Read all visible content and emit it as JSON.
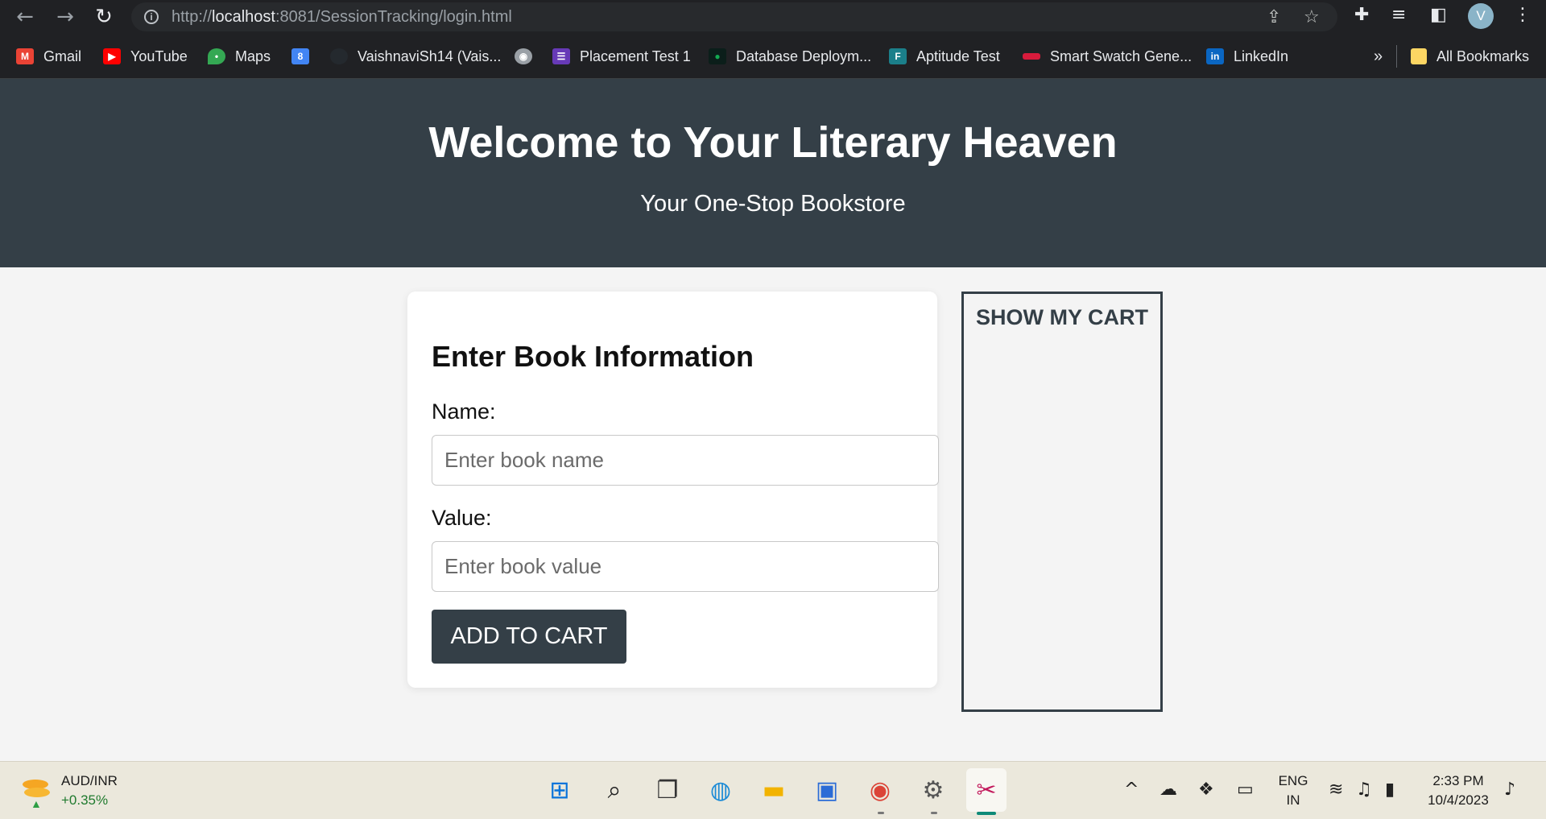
{
  "browser": {
    "url_prefix": "http://",
    "url_host": "localhost",
    "url_rest": ":8081/SessionTracking/login.html",
    "profile_initial": "V"
  },
  "bookmarks": [
    {
      "label": "Gmail",
      "icon": "gmail-icon",
      "color": "#ea4335"
    },
    {
      "label": "YouTube",
      "icon": "youtube-icon",
      "color": "#ff0000"
    },
    {
      "label": "Maps",
      "icon": "maps-icon",
      "color": "#34a853"
    },
    {
      "label": "VaishnaviSh14 (Vais...",
      "icon": "github-icon",
      "color": "#24292e"
    },
    {
      "label": "Placement Test 1",
      "icon": "forms-icon",
      "color": "#673ab7"
    },
    {
      "label": "Database Deploym...",
      "icon": "mongodb-icon",
      "color": "#13aa52"
    },
    {
      "label": "Aptitude Test",
      "icon": "test-icon",
      "color": "#1b7f8a"
    },
    {
      "label": "Smart Swatch Gene...",
      "icon": "swatch-icon",
      "color": "#d81b3c"
    },
    {
      "label": "LinkedIn",
      "icon": "linkedin-icon",
      "color": "#0a66c2"
    }
  ],
  "bookmarks_more": "»",
  "all_bookmarks": "All Bookmarks",
  "page": {
    "title": "Welcome to Your Literary Heaven",
    "subtitle": "Your One-Stop Bookstore",
    "form_heading": "Enter Book Information",
    "name_label": "Name:",
    "name_placeholder": "Enter book name",
    "value_label": "Value:",
    "value_placeholder": "Enter book value",
    "add_button": "ADD TO CART",
    "cart_label": "SHOW MY CART"
  },
  "taskbar": {
    "widget_title": "AUD/INR",
    "widget_value": "+0.35%",
    "lang_top": "ENG",
    "lang_bottom": "IN",
    "time": "2:33 PM",
    "date": "10/4/2023"
  }
}
